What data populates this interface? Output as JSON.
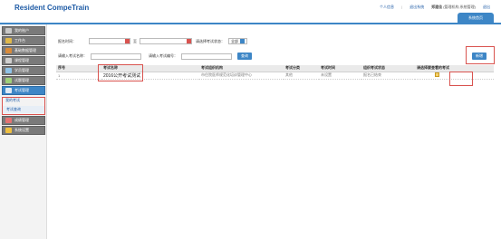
{
  "header": {
    "logo": "Resident CompeTrain",
    "nav": {
      "link1": "个人信息",
      "sep": "|",
      "link2": "退出系统",
      "user": "郑建佳",
      "user_detail": "(管理机构,系统管理)",
      "logout": "退出"
    },
    "subtab": "系统首页"
  },
  "sidebar": {
    "items": [
      {
        "label": "我的账户",
        "icon": "user-icon"
      },
      {
        "label": "工作台",
        "icon": "desk-icon"
      },
      {
        "label": "基础数据管理",
        "icon": "data-icon"
      },
      {
        "label": "课程管理",
        "icon": "course-icon"
      },
      {
        "label": "学员管理",
        "icon": "students-icon"
      },
      {
        "label": "试题管理",
        "icon": "questions-icon"
      },
      {
        "label": "考试管理",
        "icon": "exam-icon"
      }
    ],
    "sub_items": [
      {
        "label": "我的考试"
      },
      {
        "label": "考试查询"
      }
    ],
    "items_after": [
      {
        "label": "成绩管理",
        "icon": "score-icon"
      },
      {
        "label": "系统设置",
        "icon": "settings-icon"
      }
    ]
  },
  "filters": {
    "date_label": "报名时间：",
    "date_to": "至",
    "status_label": "请选择考试状态：",
    "status_value": "全部",
    "name_label": "请输入考试名称：",
    "code_label": "请输入考试编号：",
    "search_button": "查询"
  },
  "add_button": "新增",
  "table": {
    "headers": [
      "序号",
      "考试名称",
      "考试组织机构",
      "考试分类",
      "考试时间",
      "组织考试状态",
      "请选择要查看的考试"
    ],
    "rows": [
      {
        "index": "1",
        "name": "2016公开考试测试",
        "org": "市住院医师规范化培训管理中心",
        "category": "其他",
        "time": "未设置",
        "status": "报名已结束"
      }
    ]
  },
  "colors": {
    "accent": "#3d86c6",
    "highlight": "#d9534f"
  }
}
